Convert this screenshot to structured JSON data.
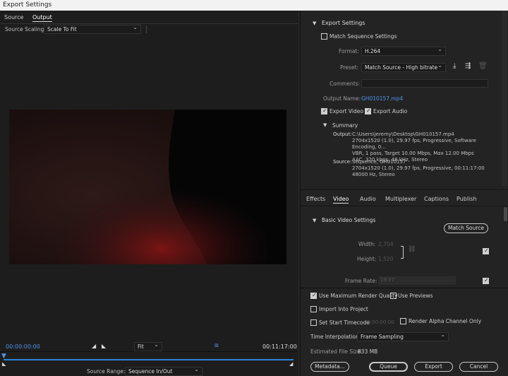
{
  "window": {
    "title": "Export Settings"
  },
  "left_panel": {
    "tabs": [
      "Source",
      "Output"
    ],
    "source_scaling": {
      "label": "Source Scaling:",
      "value": "Scale To Fit"
    },
    "timeline": {
      "current_timecode": "00:00:00:00",
      "end_timecode": "00:11:17:00",
      "fit": "Fit",
      "source_range_label": "Source Range:",
      "source_range_value": "Sequence In/Out"
    }
  },
  "export_settings": {
    "section_title": "Export Settings",
    "match_sequence": "Match Sequence Settings",
    "format_label": "Format:",
    "format_value": "H.264",
    "preset_label": "Preset:",
    "preset_value": "Match Source - High bitrate",
    "comments_label": "Comments:",
    "output_name_label": "Output Name:",
    "output_name_value": "GH010157.mp4",
    "export_video": "Export Video",
    "export_audio": "Export Audio"
  },
  "summary": {
    "title": "Summary",
    "output_label": "Output:",
    "output_lines": [
      "C:\\Users\\jeremy\\Desktop\\GH010157.mp4",
      "2704x1520 (1.0), 29.97 fps, Progressive, Software Encoding, 0...",
      "VBR, 1 pass, Target 10.00 Mbps, Max 12.00 Mbps",
      "AAC, 320 kbps, 48 kHz, Stereo"
    ],
    "source_label": "Source:",
    "source_lines": [
      "Sequence, GH010157",
      "2704x1520 (1.0), 29.97 fps, Progressive, 00:11:17:00",
      "48000 Hz, Stereo"
    ]
  },
  "settings_tabs": [
    "Effects",
    "Video",
    "Audio",
    "Multiplexer",
    "Captions",
    "Publish"
  ],
  "video": {
    "section_title": "Basic Video Settings",
    "match_source": "Match Source",
    "width_label": "Width:",
    "width_value": "2,704",
    "height_label": "Height:",
    "height_value": "1,520",
    "frame_rate_label": "Frame Rate:",
    "frame_rate_value": "29.97"
  },
  "bottom": {
    "max_render_quality": "Use Maximum Render Quality",
    "use_previews": "Use Previews",
    "import_into_project": "Import Into Project",
    "set_start_timecode": "Set Start Timecode",
    "start_timecode_value": "00:00:00:00",
    "render_alpha": "Render Alpha Channel Only",
    "time_interpolation_label": "Time Interpolation:",
    "time_interpolation_value": "Frame Sampling",
    "estimated_file_size_label": "Estimated File Size:",
    "estimated_file_size_value": "833 MB",
    "buttons": {
      "metadata": "Metadata...",
      "queue": "Queue",
      "export": "Export",
      "cancel": "Cancel"
    }
  }
}
